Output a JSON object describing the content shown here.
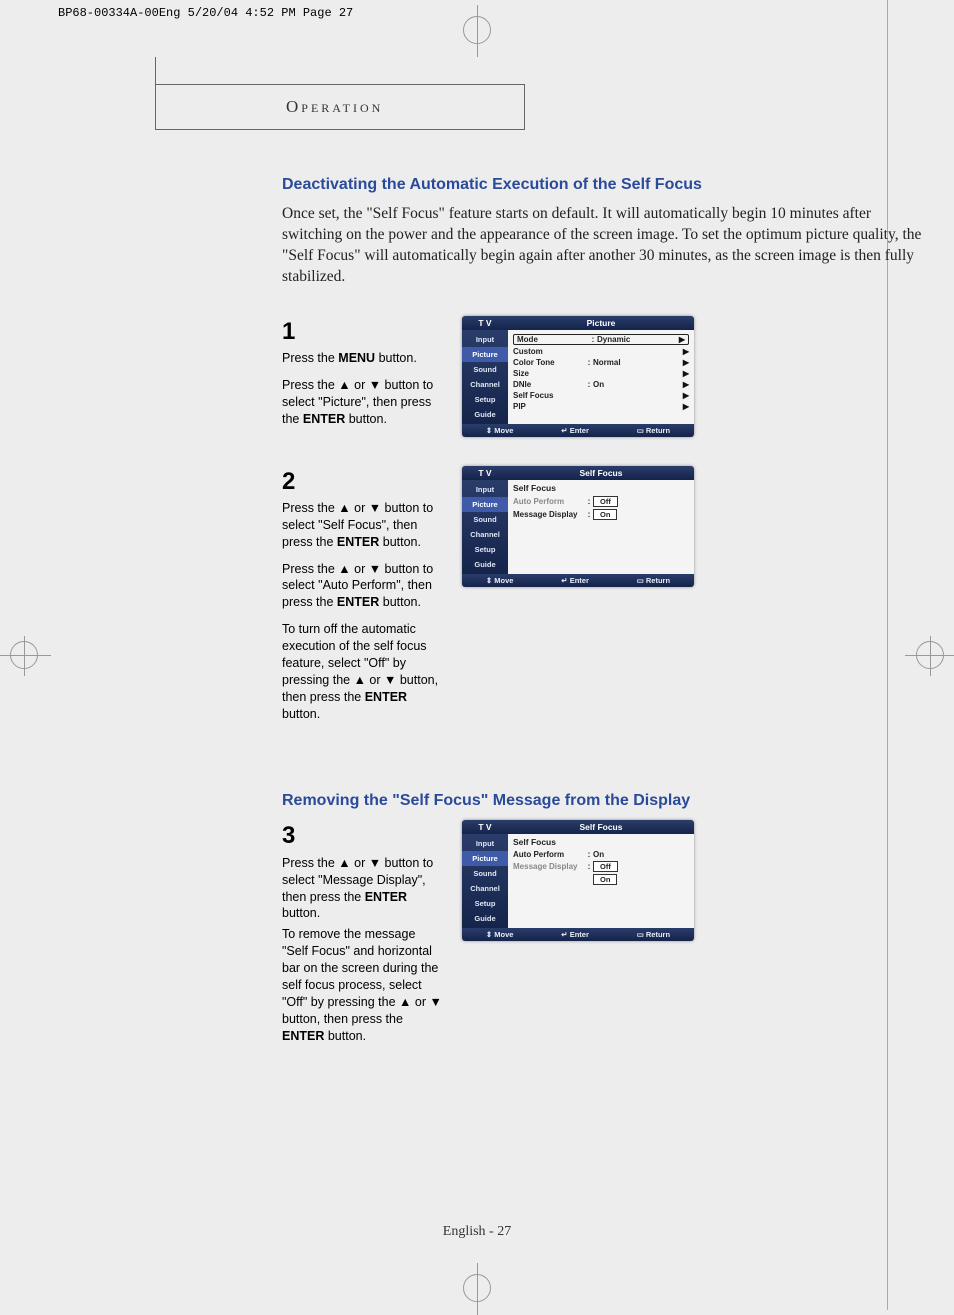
{
  "meta": {
    "headerLine": "BP68-00334A-00Eng  5/20/04  4:52 PM  Page 27"
  },
  "section": {
    "label": "Operation"
  },
  "titles": {
    "t1": "Deactivating the Automatic Execution of the Self Focus",
    "t2": "Removing the \"Self Focus\" Message from the Display"
  },
  "intro": "Once set, the \"Self Focus\" feature starts on default. It will automatically begin 10 minutes after switching on the power and the appearance of the screen image. To set the optimum picture quality, the \"Self Focus\" will automatically begin again after another 30 minutes, as the screen image is then fully stabilized.",
  "steps": {
    "s1": {
      "num": "1",
      "p1a": "Press the ",
      "p1b": "MENU",
      "p1c": " button.",
      "p2a": "Press the ▲ or ▼ button to select \"Picture\", then press the ",
      "p2b": "ENTER",
      "p2c": " button."
    },
    "s2": {
      "num": "2",
      "p1a": "Press the ▲ or ▼ button to select \"Self Focus\", then press the ",
      "p1b": "ENTER",
      "p1c": " button.",
      "p2a": "Press the ▲ or ▼ button to select \"Auto Perform\", then press the ",
      "p2b": "ENTER",
      "p2c": " button.",
      "p3a": "To turn off the automatic execution of the self focus feature, select \"Off\" by pressing the ▲ or ▼ button, then press the ",
      "p3b": "ENTER",
      "p3c": " button."
    },
    "s3": {
      "num": "3",
      "p1a": "Press the ▲ or ▼ button to select \"Message Display\", then press the ",
      "p1b": "ENTER",
      "p1c": " button.",
      "p2a": "To remove the message \"Self Focus\" and horizontal bar on the screen during the self focus process, select \"Off\" by pressing the ▲ or ▼ button, then press the ",
      "p2b": "ENTER",
      "p2c": " button."
    }
  },
  "menus": {
    "common": {
      "tv": "T V",
      "side": [
        "Input",
        "Picture",
        "Sound",
        "Channel",
        "Setup",
        "Guide"
      ],
      "foot": {
        "move": "Move",
        "enter": "Enter",
        "return": "Return"
      }
    },
    "m1": {
      "title": "Picture",
      "rows": [
        {
          "k": "Mode",
          "c": ":",
          "v": "Dynamic",
          "boxed": true
        },
        {
          "k": "Custom",
          "c": "",
          "v": ""
        },
        {
          "k": "Color Tone",
          "c": ":",
          "v": "Normal"
        },
        {
          "k": "Size",
          "c": "",
          "v": ""
        },
        {
          "k": "DNIe",
          "c": ":",
          "v": "On"
        },
        {
          "k": "Self Focus",
          "c": "",
          "v": ""
        },
        {
          "k": "PIP",
          "c": "",
          "v": ""
        }
      ]
    },
    "m2": {
      "title": "Self Focus",
      "head": "Self Focus",
      "rows": [
        {
          "k": "Auto Perform",
          "c": ":",
          "v": "Off",
          "grey": true,
          "box": true
        },
        {
          "k": "Message Display",
          "c": ":",
          "v": "On",
          "box": true
        }
      ]
    },
    "m3": {
      "title": "Self Focus",
      "head": "Self Focus",
      "rows": [
        {
          "k": "Auto Perform",
          "c": ":",
          "v": "On"
        },
        {
          "k": "Message Display",
          "c": ":",
          "v": "Off",
          "grey": true,
          "box": true
        },
        {
          "k": "",
          "c": "",
          "v": "On",
          "box": true
        }
      ]
    }
  },
  "footer": {
    "text": "English - 27"
  },
  "glyphs": {
    "updown": "⇕",
    "enter": "↵",
    "ret": "▭",
    "play": "▶"
  }
}
